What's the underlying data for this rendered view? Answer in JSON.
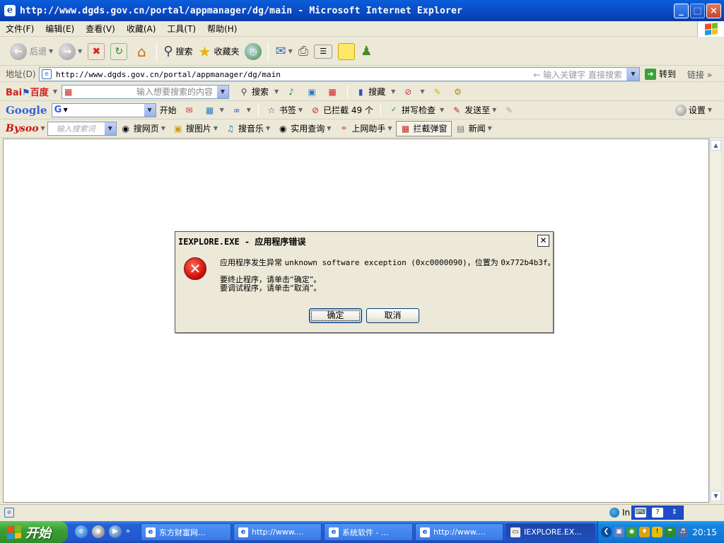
{
  "window": {
    "title": "http://www.dgds.gov.cn/portal/appmanager/dg/main - Microsoft Internet Explorer",
    "buttons": [
      "_",
      "□",
      "×"
    ]
  },
  "menu": [
    "文件(F)",
    "编辑(E)",
    "查看(V)",
    "收藏(A)",
    "工具(T)",
    "帮助(H)"
  ],
  "toolbar": {
    "back": "后退",
    "search": "搜索",
    "favorites": "收藏夹"
  },
  "address": {
    "label": "地址(D)",
    "url": "http://www.dgds.gov.cn/portal/appmanager/dg/main",
    "keyword_hint": "输入关键字 直接搜索",
    "go": "转到",
    "links": "链接"
  },
  "baidu_bar": {
    "logo_a": "Bai",
    "logo_b": "百度",
    "placeholder": "输入想要搜索的内容",
    "search": "搜索",
    "collect": "搜藏"
  },
  "google_bar": {
    "logo": "Google",
    "start": "开始",
    "bookmarks": "书签",
    "blocked": "已拦截 49 个",
    "spell": "拼写检查",
    "send": "发送至",
    "settings": "设置"
  },
  "bysoo_bar": {
    "logo": "Bysoo",
    "placeholder": "输入搜索词",
    "web": "搜网页",
    "images": "搜图片",
    "music": "搜音乐",
    "lookup": "实用查询",
    "helper": "上网助手",
    "popup_block": "拦截弹窗",
    "news": "新闻"
  },
  "status": {
    "zone": "In"
  },
  "dialog": {
    "title": "IEXPLORE.EXE - 应用程序错误",
    "line_prefix": "应用程序发生异常 ",
    "line_code": "unknown software exception (0xc0000090)",
    "line_mid": "，位置为 ",
    "line_addr": "0x772b4b3f",
    "line_end": "。",
    "terminate": "要终止程序，请单击“确定”。",
    "debug": "要调试程序，请单击“取消”。",
    "ok": "确定",
    "cancel": "取消"
  },
  "taskbar": {
    "start": "开始",
    "tasks": [
      {
        "label": "东方财富网..."
      },
      {
        "label": "http://www...."
      },
      {
        "label": "系统软件 - ..."
      },
      {
        "label": "http://www...."
      },
      {
        "label": "IEXPLORE.EX..."
      }
    ],
    "clock": "20:15"
  }
}
